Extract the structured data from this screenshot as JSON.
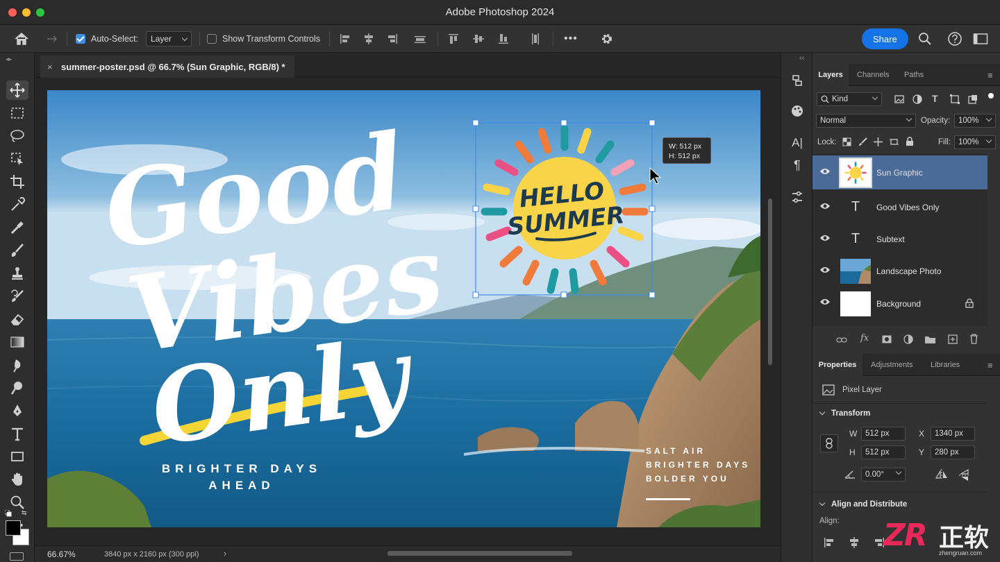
{
  "window": {
    "title": "Adobe Photoshop 2024"
  },
  "options_bar": {
    "auto_select_label": "Auto-Select:",
    "auto_select_checked": true,
    "auto_select_target": "Layer",
    "show_transform_label": "Show Transform Controls",
    "show_transform_checked": false,
    "more_label": "•••",
    "share_label": "Share"
  },
  "document": {
    "tab_title": "summer-poster.psd @ 66.7% (Sun Graphic, RGB/8) *",
    "close_glyph": "×"
  },
  "canvas": {
    "headline_lines": [
      "Good",
      "Vibes",
      "Only"
    ],
    "sun_text": [
      "HELLO",
      "SUMMER"
    ],
    "subtitle_lines": [
      "BRIGHTER DAYS",
      "AHEAD"
    ],
    "side_lines": [
      "SALT AIR",
      "BRIGHTER DAYS",
      "BOLDER YOU"
    ],
    "transform_tooltip": {
      "w": "W:  512 px",
      "h": "H:  512 px"
    }
  },
  "status": {
    "zoom": "66.67%",
    "doc_info": "3840 px x 2160 px (300 ppi)"
  },
  "layers_panel": {
    "tabs": [
      "Layers",
      "Channels",
      "Paths"
    ],
    "active_tab": "Layers",
    "filter_kind": "Kind",
    "blend_mode": "Normal",
    "opacity_label": "Opacity:",
    "opacity_value": "100%",
    "lock_label": "Lock:",
    "fill_label": "Fill:",
    "fill_value": "100%",
    "layers": [
      {
        "name": "Sun Graphic",
        "type": "pixel",
        "selected": true
      },
      {
        "name": "Good Vibes Only",
        "type": "text",
        "selected": false
      },
      {
        "name": "Subtext",
        "type": "text",
        "selected": false
      },
      {
        "name": "Landscape Photo",
        "type": "photo",
        "selected": false
      },
      {
        "name": "Background",
        "type": "background",
        "selected": false,
        "locked": true
      }
    ],
    "text_layer_glyph": "T"
  },
  "properties_panel": {
    "tabs": [
      "Properties",
      "Adjustments",
      "Libraries"
    ],
    "active_tab": "Properties",
    "layer_kind": "Pixel Layer",
    "transform_heading": "Transform",
    "w_label": "W",
    "w_value": "512 px",
    "h_label": "H",
    "h_value": "512 px",
    "x_label": "X",
    "x_value": "1340 px",
    "y_label": "Y",
    "y_value": "280 px",
    "angle_value": "0.00°",
    "align_heading": "Align and Distribute",
    "align_label": "Align:"
  },
  "watermark": {
    "logo_text": "ZR",
    "cjk_text": "正软",
    "site": "zhengruan.com"
  },
  "colors": {
    "accent": "#1473e6",
    "selection": "#4a6a98",
    "sun_yellow": "#f8d448"
  }
}
